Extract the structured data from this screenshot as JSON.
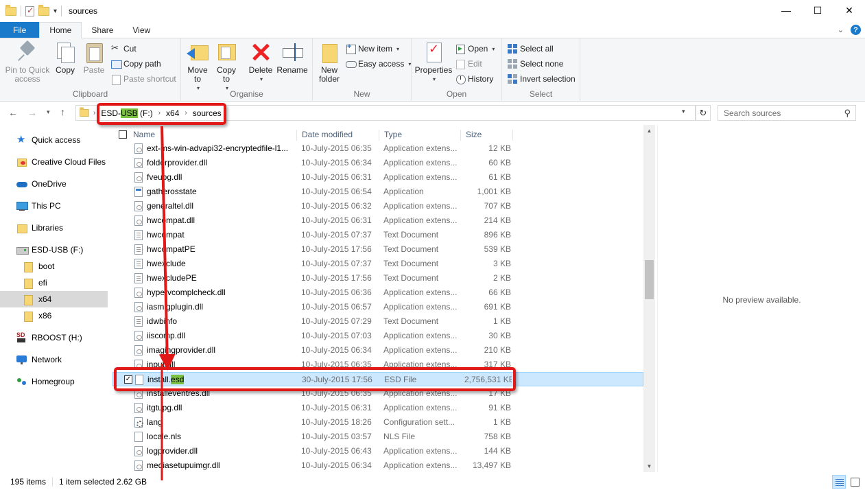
{
  "window": {
    "title": "sources",
    "controls": {
      "minimize": "—",
      "maximize": "☐",
      "close": "✕"
    }
  },
  "tabs": [
    {
      "label": "File"
    },
    {
      "label": "Home"
    },
    {
      "label": "Share"
    },
    {
      "label": "View"
    }
  ],
  "ribbon": {
    "clipboard": {
      "label": "Clipboard",
      "pin": "Pin to Quick access",
      "copy": "Copy",
      "paste": "Paste",
      "cut": "Cut",
      "copy_path": "Copy path",
      "paste_shortcut": "Paste shortcut"
    },
    "organise": {
      "label": "Organise",
      "move_to": "Move to",
      "copy_to": "Copy to",
      "delete": "Delete",
      "rename": "Rename"
    },
    "new": {
      "label": "New",
      "new_folder": "New folder",
      "new_item": "New item",
      "easy_access": "Easy access"
    },
    "open": {
      "label": "Open",
      "properties": "Properties",
      "open": "Open",
      "edit": "Edit",
      "history": "History"
    },
    "select": {
      "label": "Select",
      "select_all": "Select all",
      "select_none": "Select none",
      "invert": "Invert selection"
    }
  },
  "address": {
    "crumbs": [
      "ESD-USB (F:)",
      "x64",
      "sources"
    ],
    "highlight": "USB",
    "search_placeholder": "Search sources"
  },
  "navpane": [
    {
      "label": "Quick access",
      "icon": "star-icon"
    },
    {
      "label": "Creative Cloud Files",
      "icon": "creative-cloud-icon"
    },
    {
      "label": "OneDrive",
      "icon": "cloud-icon"
    },
    {
      "label": "This PC",
      "icon": "computer-icon"
    },
    {
      "label": "Libraries",
      "icon": "library-icon"
    },
    {
      "label": "ESD-USB (F:)",
      "icon": "drive-icon"
    },
    {
      "label": "boot",
      "icon": "folder-icon"
    },
    {
      "label": "efi",
      "icon": "folder-icon"
    },
    {
      "label": "x64",
      "icon": "folder-icon",
      "selected": true
    },
    {
      "label": "x86",
      "icon": "folder-icon"
    },
    {
      "label": "RBOOST (H:)",
      "icon": "sd-drive-icon"
    },
    {
      "label": "Network",
      "icon": "network-icon"
    },
    {
      "label": "Homegroup",
      "icon": "homegroup-icon"
    }
  ],
  "columns": {
    "name": "Name",
    "date": "Date modified",
    "type": "Type",
    "size": "Size"
  },
  "files": [
    {
      "name": "ext-ms-win-advapi32-encryptedfile-l1...",
      "date": "10-July-2015 06:35",
      "type": "Application extens...",
      "size": "12 KB",
      "icon": "dll"
    },
    {
      "name": "folderprovider.dll",
      "date": "10-July-2015 06:34",
      "type": "Application extens...",
      "size": "60 KB",
      "icon": "dll"
    },
    {
      "name": "fveupg.dll",
      "date": "10-July-2015 06:31",
      "type": "Application extens...",
      "size": "61 KB",
      "icon": "dll"
    },
    {
      "name": "gatherosstate",
      "date": "10-July-2015 06:54",
      "type": "Application",
      "size": "1,001 KB",
      "icon": "app"
    },
    {
      "name": "generaltel.dll",
      "date": "10-July-2015 06:32",
      "type": "Application extens...",
      "size": "707 KB",
      "icon": "dll"
    },
    {
      "name": "hwcompat.dll",
      "date": "10-July-2015 06:31",
      "type": "Application extens...",
      "size": "214 KB",
      "icon": "dll"
    },
    {
      "name": "hwcompat",
      "date": "10-July-2015 07:37",
      "type": "Text Document",
      "size": "896 KB",
      "icon": "txt"
    },
    {
      "name": "hwcompatPE",
      "date": "10-July-2015 17:56",
      "type": "Text Document",
      "size": "539 KB",
      "icon": "txt"
    },
    {
      "name": "hwexclude",
      "date": "10-July-2015 07:37",
      "type": "Text Document",
      "size": "3 KB",
      "icon": "txt"
    },
    {
      "name": "hwexcludePE",
      "date": "10-July-2015 17:56",
      "type": "Text Document",
      "size": "2 KB",
      "icon": "txt"
    },
    {
      "name": "hypervcomplcheck.dll",
      "date": "10-July-2015 06:36",
      "type": "Application extens...",
      "size": "66 KB",
      "icon": "dll"
    },
    {
      "name": "iasmigplugin.dll",
      "date": "10-July-2015 06:57",
      "type": "Application extens...",
      "size": "691 KB",
      "icon": "dll"
    },
    {
      "name": "idwbinfo",
      "date": "10-July-2015 07:29",
      "type": "Text Document",
      "size": "1 KB",
      "icon": "txt"
    },
    {
      "name": "iiscomp.dll",
      "date": "10-July-2015 07:03",
      "type": "Application extens...",
      "size": "30 KB",
      "icon": "dll"
    },
    {
      "name": "imagingprovider.dll",
      "date": "10-July-2015 06:34",
      "type": "Application extens...",
      "size": "210 KB",
      "icon": "dll"
    },
    {
      "name": "input.dll",
      "date": "10-July-2015 06:35",
      "type": "Application extens...",
      "size": "317 KB",
      "icon": "dll"
    },
    {
      "name": "install.esd",
      "date": "30-July-2015 17:56",
      "type": "ESD File",
      "size": "2,756,531 KB",
      "icon": "file",
      "selected": true
    },
    {
      "name": "installeventres.dll",
      "date": "10-July-2015 06:35",
      "type": "Application extens...",
      "size": "17 KB",
      "icon": "dll"
    },
    {
      "name": "itgtupg.dll",
      "date": "10-July-2015 06:31",
      "type": "Application extens...",
      "size": "91 KB",
      "icon": "dll"
    },
    {
      "name": "lang",
      "date": "10-July-2015 18:26",
      "type": "Configuration sett...",
      "size": "1 KB",
      "icon": "cfg"
    },
    {
      "name": "locale.nls",
      "date": "10-July-2015 03:57",
      "type": "NLS File",
      "size": "758 KB",
      "icon": "file"
    },
    {
      "name": "logprovider.dll",
      "date": "10-July-2015 06:43",
      "type": "Application extens...",
      "size": "144 KB",
      "icon": "dll"
    },
    {
      "name": "mediasetupuimgr.dll",
      "date": "10-July-2015 06:34",
      "type": "Application extens...",
      "size": "13,497 KB",
      "icon": "dll"
    }
  ],
  "preview": {
    "text": "No preview available."
  },
  "status": {
    "items": "195 items",
    "selected": "1 item selected",
    "size": "2.62 GB"
  },
  "colors": {
    "file_tab": "#1979ca",
    "selection": "#cce8ff",
    "annotation": "#e01818",
    "highlight": "#7bc142"
  }
}
